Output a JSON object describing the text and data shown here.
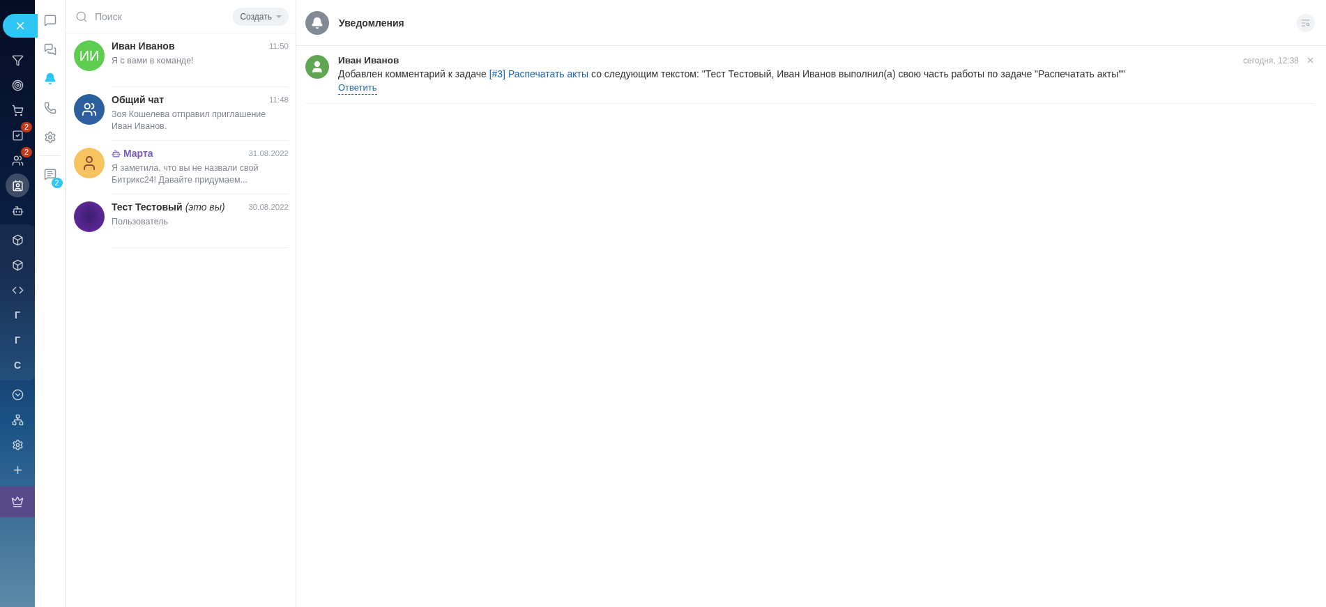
{
  "left_rail": {
    "close": {
      "selected": false
    },
    "top": [
      {
        "kind": "icon",
        "selected": false
      },
      {
        "kind": "icon",
        "selected": false
      },
      {
        "kind": "icon",
        "selected": false
      },
      {
        "kind": "icon",
        "selected": false,
        "badge": "2"
      },
      {
        "kind": "icon",
        "selected": false,
        "badge": "2"
      },
      {
        "kind": "icon",
        "selected": true
      },
      {
        "kind": "icon",
        "selected": false
      }
    ],
    "group": [
      {
        "kind": "icon",
        "selected": false
      },
      {
        "kind": "icon",
        "selected": false
      },
      {
        "kind": "icon",
        "selected": false
      },
      {
        "kind": "letter",
        "label": "Г",
        "selected": false
      },
      {
        "kind": "letter",
        "label": "Г",
        "selected": false
      },
      {
        "kind": "letter",
        "label": "С",
        "selected": false
      }
    ],
    "bottom": [
      {
        "kind": "icon",
        "selected": false
      },
      {
        "kind": "icon",
        "selected": false
      },
      {
        "kind": "icon",
        "selected": false
      },
      {
        "kind": "icon",
        "selected": false
      },
      {
        "kind": "crown",
        "selected": false
      }
    ]
  },
  "icon_rail": {
    "items": [
      {
        "selected": false
      },
      {
        "selected": false
      },
      {
        "selected": true
      },
      {
        "selected": false
      },
      {
        "selected": false
      },
      {
        "selected": false,
        "badge": "2"
      }
    ]
  },
  "chat_list": {
    "search": {
      "placeholder": "Поиск"
    },
    "create_button": "Создать",
    "chats": [
      {
        "avatar": {
          "kind": "initials",
          "label": "ИИ"
        },
        "name": "Иван Иванов",
        "kind": "user",
        "time": "11:50",
        "preview": "Я с вами в команде!"
      },
      {
        "avatar": {
          "kind": "group"
        },
        "name": "Общий чат",
        "kind": "user",
        "time": "11:48",
        "preview": "Зоя Кошелева отправил приглашение Иван Иванов."
      },
      {
        "avatar": {
          "kind": "cartoon"
        },
        "name": "Марта",
        "kind": "bot",
        "time": "31.08.2022",
        "preview": "Я заметила, что вы не назвали свой Битрикс24! Давайте придумаем..."
      },
      {
        "avatar": {
          "kind": "photo"
        },
        "name": "Тест Тестовый",
        "note": "(это вы)",
        "kind": "user",
        "time": "30.08.2022",
        "preview": "Пользователь"
      }
    ]
  },
  "main": {
    "title": "Уведомления",
    "notifications": [
      {
        "author": "Иван Иванов",
        "time": "сегодня, 12:38",
        "text_before": "Добавлен комментарий к задаче ",
        "link": "[#3] Распечатать акты",
        "text_after": " со следующим текстом: \"Тест Тестовый, Иван Иванов выполнил(а) свою часть работы по задаче \"Распечатать акты\"\"",
        "reply": "Ответить"
      }
    ]
  }
}
